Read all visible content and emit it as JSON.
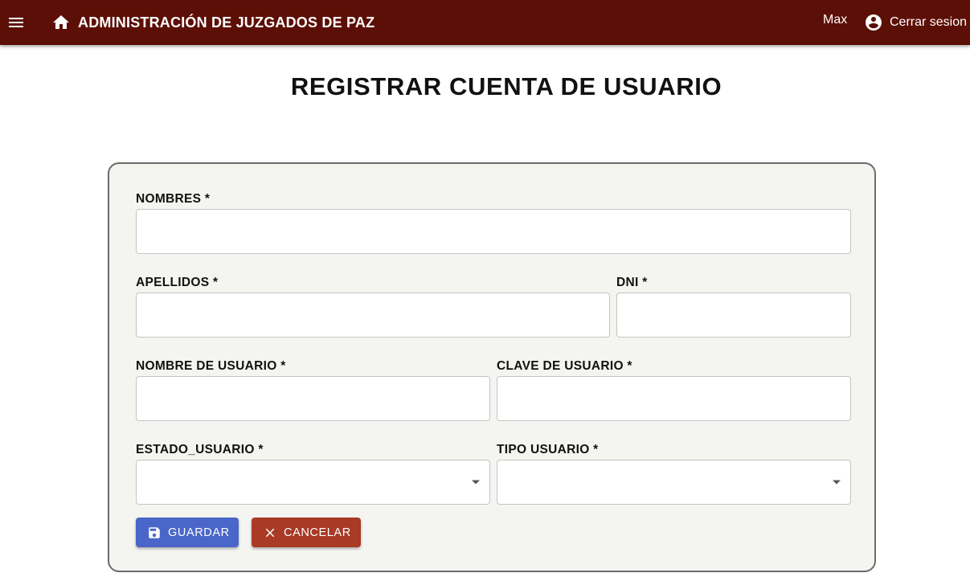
{
  "header": {
    "title": "ADMINISTRACIÓN DE JUZGADOS DE PAZ",
    "user_name": "Max",
    "logout_label": "Cerrar sesion",
    "background_color": "#5c0f06",
    "icons": [
      "menu-icon",
      "home-icon",
      "account-circle-icon"
    ]
  },
  "page": {
    "title": "REGISTRAR CUENTA DE USUARIO"
  },
  "form": {
    "nombres": {
      "label": "NOMBRES *",
      "value": ""
    },
    "apellidos": {
      "label": "APELLIDOS *",
      "value": ""
    },
    "dni": {
      "label": "DNI *",
      "value": ""
    },
    "nombre_usuario": {
      "label": "NOMBRE DE USUARIO *",
      "value": ""
    },
    "clave_usuario": {
      "label": "CLAVE DE USUARIO *",
      "value": ""
    },
    "estado_usuario": {
      "label": "ESTADO_USUARIO *",
      "value": ""
    },
    "tipo_usuario": {
      "label": "TIPO USUARIO *",
      "value": ""
    }
  },
  "actions": {
    "save_label": "GUARDAR",
    "save_icon": "save-icon",
    "save_color": "#4a66c9",
    "cancel_label": "CANCELAR",
    "cancel_icon": "close-icon",
    "cancel_color": "#a83a26"
  }
}
